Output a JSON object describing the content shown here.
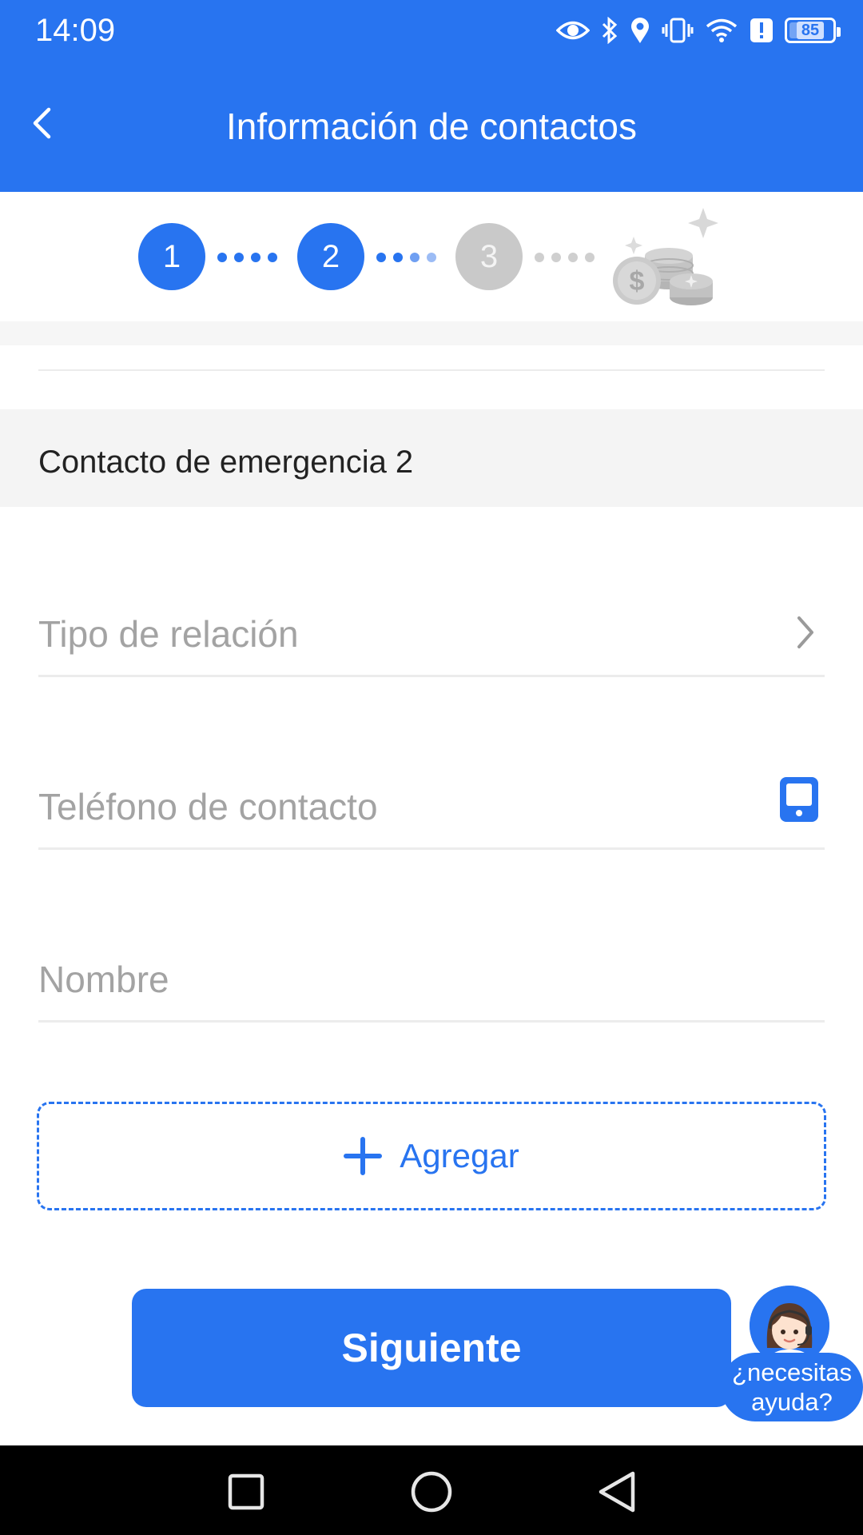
{
  "status_bar": {
    "time": "14:09",
    "battery": "85",
    "battery_level": 0.85,
    "icons": [
      "eye-icon",
      "bluetooth-icon",
      "location-icon",
      "vibrate-icon",
      "wifi-icon",
      "alert-icon",
      "battery-icon"
    ]
  },
  "header": {
    "back_icon": "chevron-left-icon",
    "title": "Información de contactos",
    "background": "#2874f0"
  },
  "stepper": {
    "steps": [
      {
        "label": "1",
        "state": "active"
      },
      {
        "label": "2",
        "state": "active"
      },
      {
        "label": "3",
        "state": "inactive"
      }
    ],
    "final_icon": "coins-icon"
  },
  "section": {
    "title": "Contacto de emergencia 2"
  },
  "form": {
    "relation_placeholder": "Tipo de relación",
    "phone_placeholder": "Teléfono de contacto",
    "name_placeholder": "Nombre"
  },
  "actions": {
    "add_label": "Agregar",
    "next_label": "Siguiente"
  },
  "help": {
    "line1": "¿necesitas",
    "line2": "ayuda?"
  },
  "colors": {
    "primary": "#2874f0",
    "placeholder": "#a3a3a3",
    "inactive_step": "#c9c9c9"
  }
}
